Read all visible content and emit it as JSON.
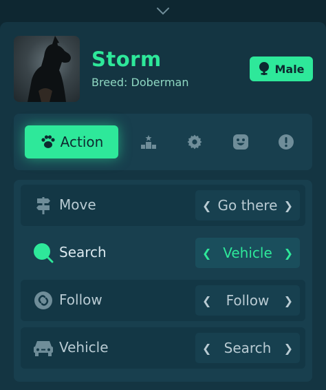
{
  "pet": {
    "name": "Storm",
    "breed_label": "Breed:",
    "breed_value": "Doberman",
    "gender": "Male"
  },
  "tabs": [
    {
      "label": "Action",
      "icon": "paw-icon",
      "active": true
    },
    {
      "label": "",
      "icon": "podium-icon",
      "active": false
    },
    {
      "label": "",
      "icon": "gear-icon",
      "active": false
    },
    {
      "label": "",
      "icon": "face-icon",
      "active": false
    },
    {
      "label": "",
      "icon": "alert-icon",
      "active": false
    }
  ],
  "actions": [
    {
      "label": "Move",
      "icon": "signpost-icon",
      "value": "Go there",
      "active": false
    },
    {
      "label": "Search",
      "icon": "search-icon",
      "value": "Vehicle",
      "active": true
    },
    {
      "label": "Follow",
      "icon": "follow-icon",
      "value": "Follow",
      "active": false
    },
    {
      "label": "Vehicle",
      "icon": "car-icon",
      "value": "Search",
      "active": false
    }
  ],
  "colors": {
    "accent": "#2ee89a",
    "background": "#0e2731",
    "panel": "#143542"
  }
}
